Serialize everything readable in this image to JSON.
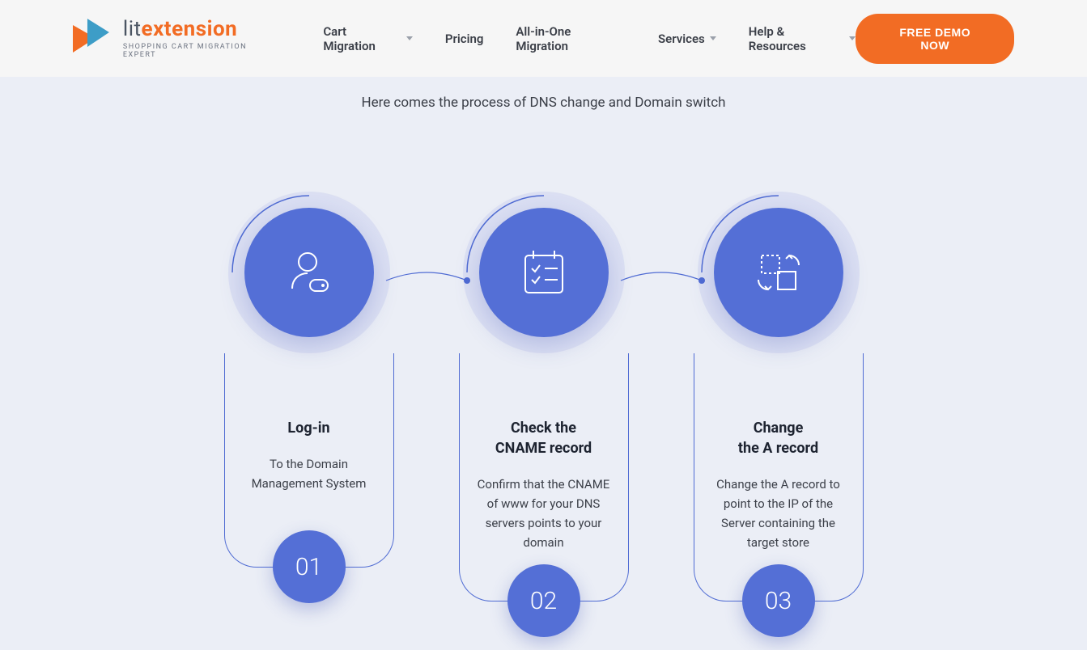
{
  "header": {
    "brand_lit": "lit",
    "brand_ext": "extension",
    "tagline": "SHOPPING CART MIGRATION EXPERT",
    "nav": {
      "cart_migration": "Cart Migration",
      "pricing": "Pricing",
      "all_in_one": "All-in-One Migration",
      "services": "Services",
      "help": "Help & Resources"
    },
    "cta": "FREE DEMO NOW"
  },
  "subtitle": "Here comes the process of DNS change and Domain switch",
  "steps": [
    {
      "number": "01",
      "title": "Log-in",
      "desc": "To the Domain Management System"
    },
    {
      "number": "02",
      "title": "Check the\nCNAME record",
      "desc": "Confirm that the CNAME of www for your DNS servers points to your domain"
    },
    {
      "number": "03",
      "title": "Change\nthe A record",
      "desc": "Change the A record to point to the IP of the Server containing the target store"
    }
  ]
}
